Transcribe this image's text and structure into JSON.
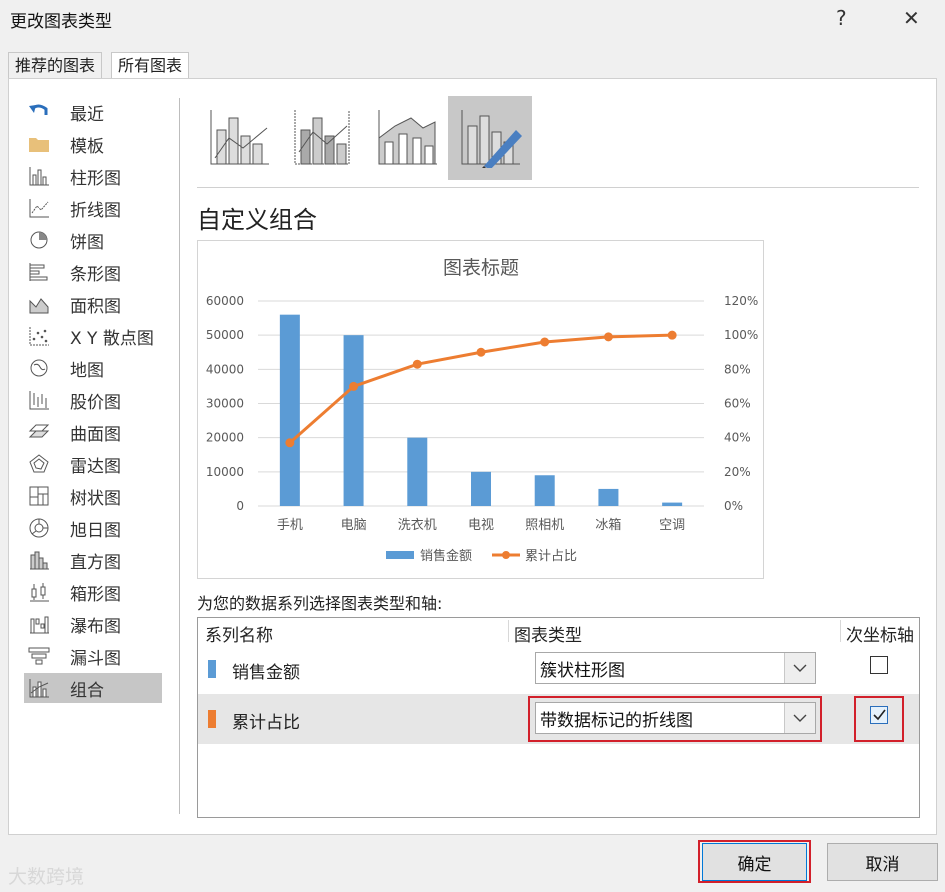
{
  "window": {
    "title": "更改图表类型",
    "help": "?",
    "close": "✕"
  },
  "tabs": [
    {
      "label": "推荐的图表"
    },
    {
      "label": "所有图表"
    }
  ],
  "categories": [
    {
      "label": "最近",
      "icon": "undo-icon"
    },
    {
      "label": "模板",
      "icon": "folder-icon"
    },
    {
      "label": "柱形图",
      "icon": "column-chart-icon"
    },
    {
      "label": "折线图",
      "icon": "line-chart-icon"
    },
    {
      "label": "饼图",
      "icon": "pie-chart-icon"
    },
    {
      "label": "条形图",
      "icon": "bar-chart-icon"
    },
    {
      "label": "面积图",
      "icon": "area-chart-icon"
    },
    {
      "label": "X Y 散点图",
      "icon": "scatter-chart-icon"
    },
    {
      "label": "地图",
      "icon": "map-chart-icon"
    },
    {
      "label": "股价图",
      "icon": "stock-chart-icon"
    },
    {
      "label": "曲面图",
      "icon": "surface-chart-icon"
    },
    {
      "label": "雷达图",
      "icon": "radar-chart-icon"
    },
    {
      "label": "树状图",
      "icon": "treemap-chart-icon"
    },
    {
      "label": "旭日图",
      "icon": "sunburst-chart-icon"
    },
    {
      "label": "直方图",
      "icon": "histogram-chart-icon"
    },
    {
      "label": "箱形图",
      "icon": "box-whisker-chart-icon"
    },
    {
      "label": "瀑布图",
      "icon": "waterfall-chart-icon"
    },
    {
      "label": "漏斗图",
      "icon": "funnel-chart-icon"
    },
    {
      "label": "组合",
      "icon": "combo-chart-icon",
      "selected": true
    }
  ],
  "combo_type_thumbs": [
    {
      "icon": "clustered-column-line-icon"
    },
    {
      "icon": "clustered-column-line-secondary-icon"
    },
    {
      "icon": "stacked-area-column-icon"
    },
    {
      "icon": "custom-combo-icon",
      "selected": true
    }
  ],
  "section_title": "自定义组合",
  "chart_data": {
    "type": "bar",
    "title": "图表标题",
    "categories": [
      "手机",
      "电脑",
      "洗衣机",
      "电视",
      "照相机",
      "冰箱",
      "空调"
    ],
    "series": [
      {
        "name": "销售金额",
        "kind": "bar",
        "axis": "primary",
        "color": "#5b9bd5",
        "values": [
          56000,
          50000,
          20000,
          10000,
          9000,
          5000,
          1000
        ]
      },
      {
        "name": "累计占比",
        "kind": "line",
        "axis": "secondary",
        "color": "#ed7d31",
        "values": [
          0.37,
          0.7,
          0.83,
          0.9,
          0.96,
          0.99,
          1.0
        ]
      }
    ],
    "ylim": [
      0,
      60000
    ],
    "yticks": [
      "0",
      "10000",
      "20000",
      "30000",
      "40000",
      "50000",
      "60000"
    ],
    "y2lim": [
      0,
      1.2
    ],
    "y2ticks": [
      "0%",
      "20%",
      "40%",
      "60%",
      "80%",
      "100%",
      "120%"
    ],
    "grid": true,
    "legend": "bottom"
  },
  "series_prompt": "为您的数据系列选择图表类型和轴:",
  "grid": {
    "headers": {
      "name": "系列名称",
      "type": "图表类型",
      "secondary": "次坐标轴"
    },
    "rows": [
      {
        "name": "销售金额",
        "color": "#5b9bd5",
        "type": "簇状柱形图",
        "secondary": false
      },
      {
        "name": "累计占比",
        "color": "#ed7d31",
        "type": "带数据标记的折线图",
        "secondary": true
      }
    ]
  },
  "buttons": {
    "ok": "确定",
    "cancel": "取消"
  },
  "watermark": "大数跨境"
}
